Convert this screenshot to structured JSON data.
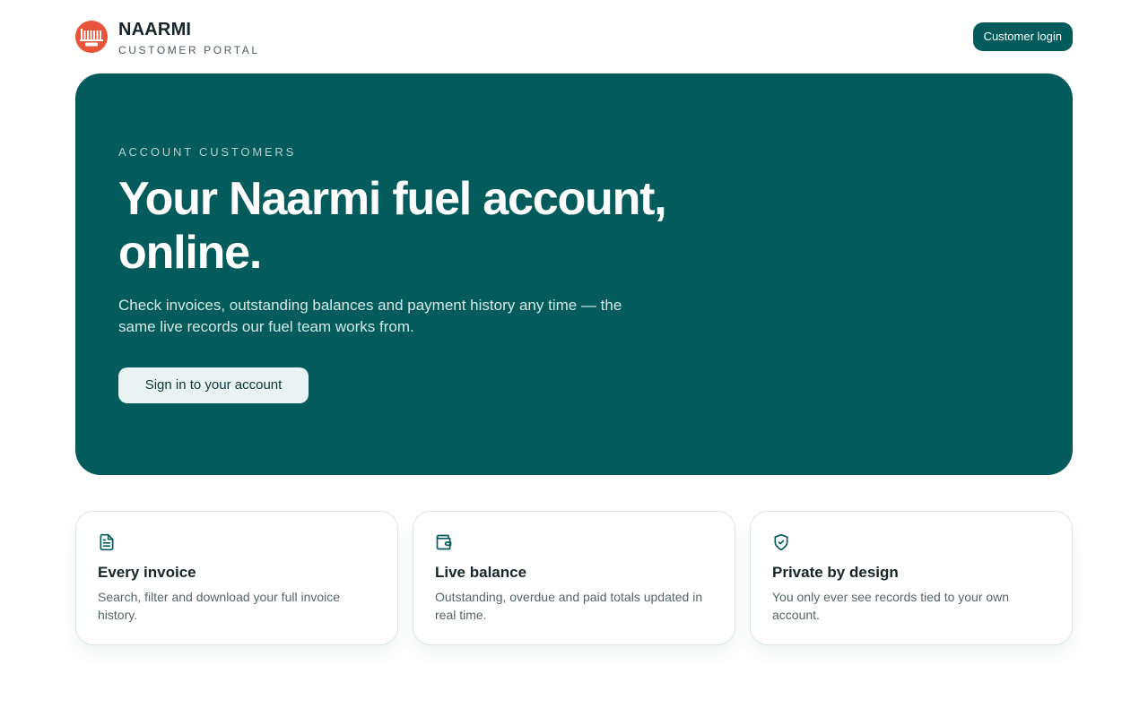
{
  "header": {
    "logo_icon": "naarmi-fuel-logo",
    "logo_color": "#e8553a",
    "brand_name": "NAARMI",
    "brand_subtitle": "CUSTOMER PORTAL",
    "login_label": "Customer login"
  },
  "hero": {
    "eyebrow": "ACCOUNT CUSTOMERS",
    "title": "Your Naarmi fuel account, online.",
    "description": "Check invoices, outstanding balances and payment history any time — the same live records our fuel team works from.",
    "cta_label": "Sign in to your account",
    "background_color": "#035b5c"
  },
  "features": [
    {
      "icon": "document-icon",
      "title": "Every invoice",
      "description": "Search, filter and download your full invoice history."
    },
    {
      "icon": "wallet-icon",
      "title": "Live balance",
      "description": "Outstanding, overdue and paid totals updated in real time."
    },
    {
      "icon": "shield-check-icon",
      "title": "Private by design",
      "description": "You only ever see records tied to your own account."
    }
  ]
}
